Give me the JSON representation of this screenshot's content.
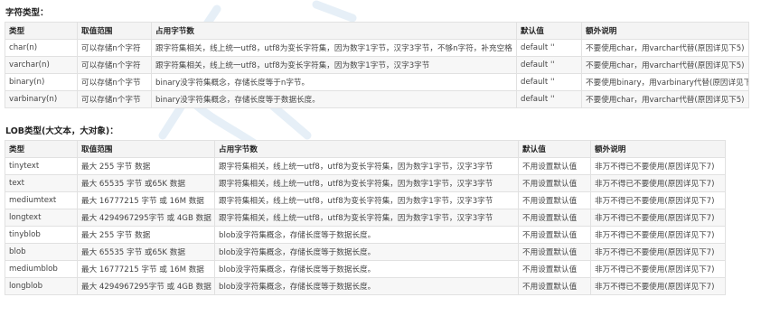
{
  "sections": {
    "string_title": "字符类型：",
    "lob_title": "LOB类型(大文本，大对象)："
  },
  "table1": {
    "headers": [
      "类型",
      "取值范围",
      "占用字节数",
      "默认值",
      "额外说明"
    ],
    "rows": [
      [
        "char(n)",
        "可以存储n个字符",
        "跟字符集相关，线上统一utf8，utf8为变长字符集，因为数字1字节，汉字3字节，不够n字符，补充空格",
        "default ''",
        "不要使用char，用varchar代替(原因详见下5)"
      ],
      [
        "varchar(n)",
        "可以存储n个字符",
        "跟字符集相关，线上统一utf8，utf8为变长字符集，因为数字1字节，汉字3字节",
        "default ''",
        "不要使用char，用varchar代替(原因详见下5)"
      ],
      [
        "binary(n)",
        "可以存储n个字节",
        "binary没字符集概念，存储长度等于n字节。",
        "default ''",
        "不要使用binary，用varbinary代替(原因详见下5)"
      ],
      [
        "varbinary(n)",
        "可以存储n个字节",
        "binary没字符集概念，存储长度等于数据长度。",
        "default ''",
        "不要使用char，用varchar代替(原因详见下5)"
      ]
    ]
  },
  "table2": {
    "headers": [
      "类型",
      "取值范围",
      "占用字节数",
      "默认值",
      "额外说明"
    ],
    "rows": [
      [
        "tinytext",
        "最大 255 字节 数据",
        "跟字符集相关，线上统一utf8，utf8为变长字符集，因为数字1字节，汉字3字节",
        "不用设置默认值",
        "非万不得已不要使用(原因详见下7)"
      ],
      [
        "text",
        "最大 65535 字节 或65K 数据",
        "跟字符集相关，线上统一utf8，utf8为变长字符集，因为数字1字节，汉字3字节",
        "不用设置默认值",
        "非万不得已不要使用(原因详见下7)"
      ],
      [
        "mediumtext",
        "最大 16777215 字节 或 16M 数据",
        "跟字符集相关，线上统一utf8，utf8为变长字符集，因为数字1字节，汉字3字节",
        "不用设置默认值",
        "非万不得已不要使用(原因详见下7)"
      ],
      [
        "longtext",
        "最大 4294967295字节 或 4GB 数据",
        "跟字符集相关，线上统一utf8，utf8为变长字符集，因为数字1字节，汉字3字节",
        "不用设置默认值",
        "非万不得已不要使用(原因详见下7)"
      ],
      [
        "tinyblob",
        "最大 255 字节 数据",
        "blob没字符集概念，存储长度等于数据长度。",
        "不用设置默认值",
        "非万不得已不要使用(原因详见下7)"
      ],
      [
        "blob",
        "最大 65535 字节 或65K 数据",
        "blob没字符集概念，存储长度等于数据长度。",
        "不用设置默认值",
        "非万不得已不要使用(原因详见下7)"
      ],
      [
        "mediumblob",
        "最大 16777215 字节 或 16M 数据",
        "blob没字符集概念，存储长度等于数据长度。",
        "不用设置默认值",
        "非万不得已不要使用(原因详见下7)"
      ],
      [
        "longblob",
        "最大 4294967295字节 或 4GB 数据",
        "blob没字符集概念，存储长度等于数据长度。",
        "不用设置默认值",
        "非万不得已不要使用(原因详见下7)"
      ]
    ]
  },
  "colors": {
    "border": "#e1e1e1",
    "header_bg": "#f4f4f4",
    "stripe_bg": "#f7f7f7",
    "watermark": "#b8d4ea"
  }
}
